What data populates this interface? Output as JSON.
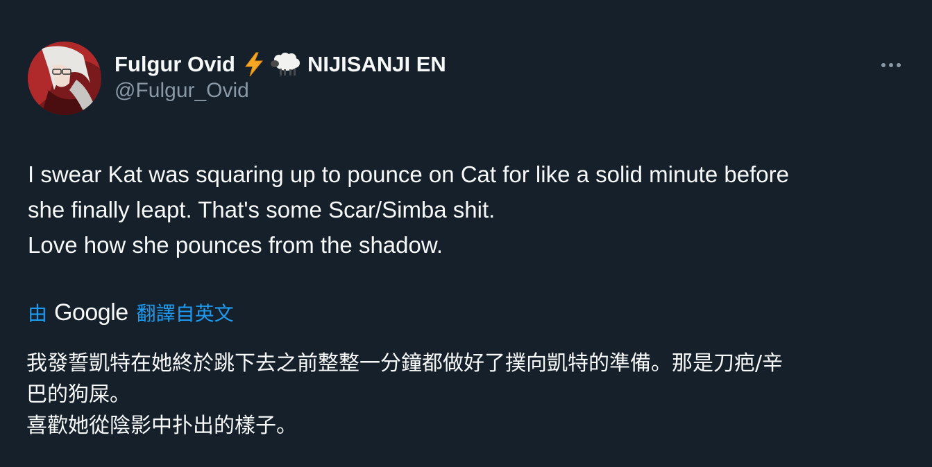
{
  "author": {
    "display_name": "Fulgur Ovid",
    "display_name_suffix": "NIJISANJI EN",
    "handle": "@Fulgur_Ovid"
  },
  "icons": {
    "avatar": "avatar",
    "bolt": "lightning-bolt-icon",
    "sheep": "sheep-icon",
    "more": "more-options-icon"
  },
  "tweet": {
    "lines": [
      "I swear Kat was squaring up to pounce on Cat for like a solid minute before",
      "she finally leapt. That's some Scar/Simba shit.",
      "Love how she pounces from the shadow."
    ]
  },
  "translation": {
    "by_label": "由",
    "provider": "Google",
    "from_label": "翻譯自英文",
    "lines": [
      "我發誓凱特在她終於跳下去之前整整一分鐘都做好了撲向凱特的準備。那是刀疤/辛",
      "巴的狗屎。",
      "喜歡她從陰影中扑出的樣子。"
    ]
  },
  "colors": {
    "background": "#15202b",
    "text_primary": "#f7f9f9",
    "text_secondary": "#8b98a5",
    "link": "#1d9bf0",
    "bolt": "#f5a623"
  }
}
